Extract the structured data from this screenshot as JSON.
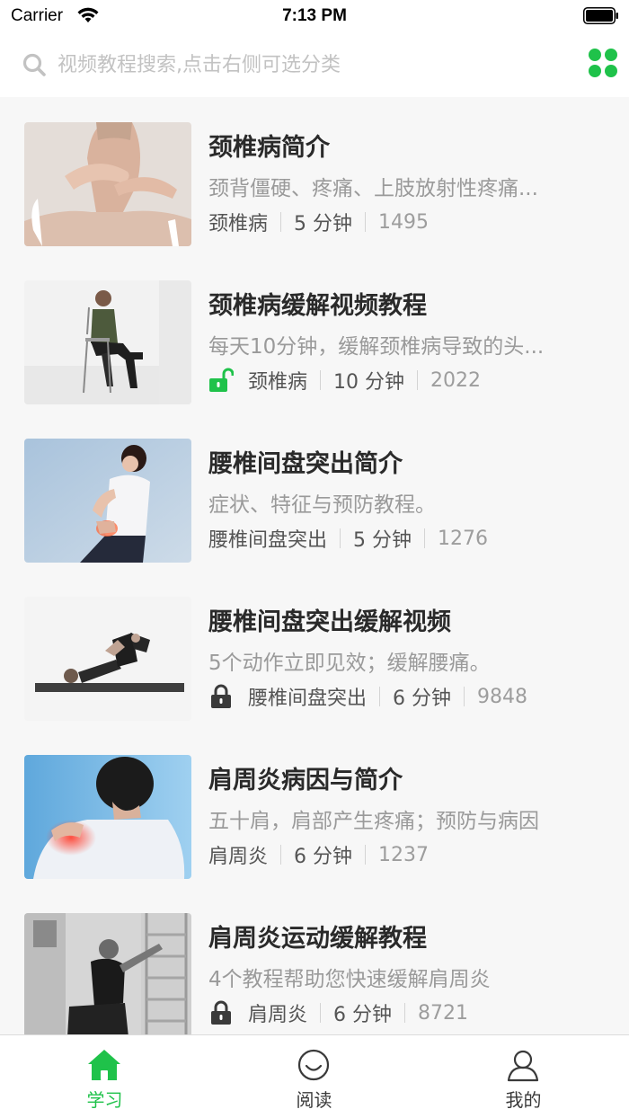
{
  "status_bar": {
    "carrier": "Carrier",
    "time": "7:13 PM"
  },
  "search": {
    "placeholder": "视频教程搜索,点击右侧可选分类",
    "icon": "search-icon"
  },
  "accent_color": "#1fc24a",
  "videos": [
    {
      "title": "颈椎病简介",
      "description": "颈背僵硬、疼痛、上肢放射性疼痛...",
      "category": "颈椎病",
      "duration": "5 分钟",
      "views": "1495",
      "lock": "none"
    },
    {
      "title": "颈椎病缓解视频教程",
      "description": "每天10分钟，缓解颈椎病导致的头...",
      "category": "颈椎病",
      "duration": "10 分钟",
      "views": "2022",
      "lock": "unlocked"
    },
    {
      "title": "腰椎间盘突出简介",
      "description": "症状、特征与预防教程。",
      "category": "腰椎间盘突出",
      "duration": "5 分钟",
      "views": "1276",
      "lock": "none"
    },
    {
      "title": "腰椎间盘突出缓解视频",
      "description": "5个动作立即见效；缓解腰痛。",
      "category": "腰椎间盘突出",
      "duration": "6 分钟",
      "views": "9848",
      "lock": "locked"
    },
    {
      "title": "肩周炎病因与简介",
      "description": "五十肩，肩部产生疼痛；预防与病因",
      "category": "肩周炎",
      "duration": "6 分钟",
      "views": "1237",
      "lock": "none"
    },
    {
      "title": "肩周炎运动缓解教程",
      "description": "4个教程帮助您快速缓解肩周炎",
      "category": "肩周炎",
      "duration": "6 分钟",
      "views": "8721",
      "lock": "locked"
    }
  ],
  "tabs": [
    {
      "label": "学习",
      "icon": "home-icon",
      "active": true
    },
    {
      "label": "阅读",
      "icon": "smiley-icon",
      "active": false
    },
    {
      "label": "我的",
      "icon": "person-icon",
      "active": false
    }
  ]
}
